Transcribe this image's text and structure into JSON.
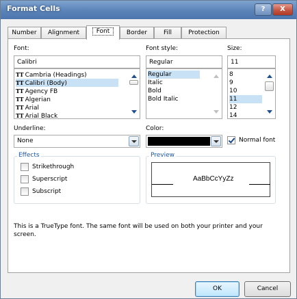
{
  "window": {
    "title": "Format Cells",
    "help_label": "?",
    "close_label": "X"
  },
  "tabs": [
    "Number",
    "Alignment",
    "Font",
    "Border",
    "Fill",
    "Protection"
  ],
  "active_tab": "Font",
  "font": {
    "label": "Font:",
    "value": "Calibri",
    "items": [
      "Cambria (Headings)",
      "Calibri (Body)",
      "Agency FB",
      "Algerian",
      "Arial",
      "Arial Black"
    ],
    "selected": "Calibri (Body)"
  },
  "font_style": {
    "label": "Font style:",
    "value": "Regular",
    "items": [
      "Regular",
      "Italic",
      "Bold",
      "Bold Italic"
    ],
    "selected": "Regular"
  },
  "size": {
    "label": "Size:",
    "value": "11",
    "items": [
      "8",
      "9",
      "10",
      "11",
      "12",
      "14"
    ],
    "selected": "11"
  },
  "underline": {
    "label": "Underline:",
    "value": "None"
  },
  "color": {
    "label": "Color:",
    "swatch_hex": "#000000"
  },
  "normal_font": {
    "label": "Normal font",
    "checked": true
  },
  "effects": {
    "legend": "Effects",
    "strikethrough": "Strikethrough",
    "superscript": "Superscript",
    "subscript": "Subscript"
  },
  "preview": {
    "legend": "Preview",
    "sample": "AaBbCcYyZz"
  },
  "note": "This is a TrueType font.  The same font will be used on both your printer and your screen.",
  "buttons": {
    "ok": "OK",
    "cancel": "Cancel"
  },
  "icons": {
    "truetype": "TT",
    "help": "?",
    "close": "X"
  }
}
